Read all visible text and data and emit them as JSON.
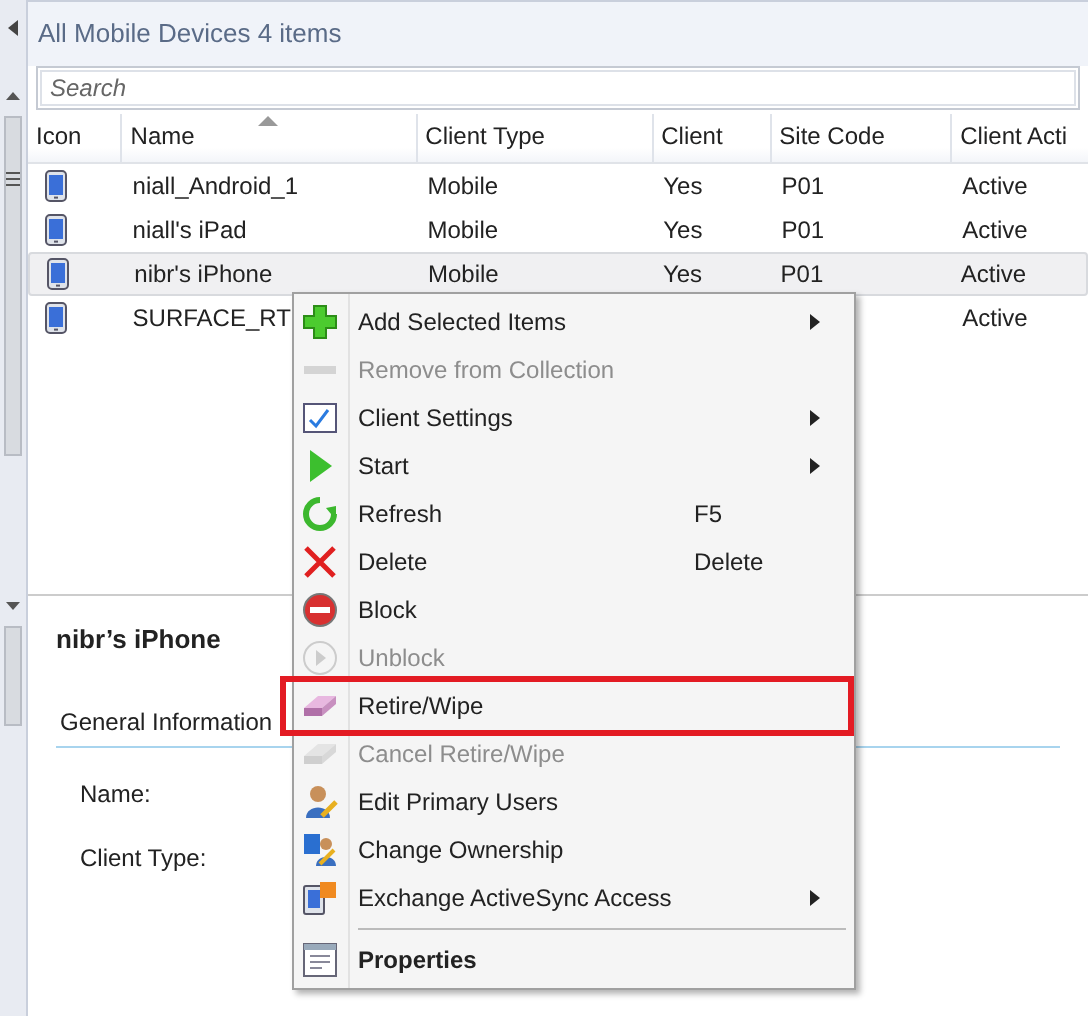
{
  "header": {
    "title": "All Mobile Devices 4 items"
  },
  "search": {
    "placeholder": "Search"
  },
  "table": {
    "columns": [
      {
        "label": "Icon",
        "sorted": false
      },
      {
        "label": "Name",
        "sorted": true
      },
      {
        "label": "Client Type",
        "sorted": false
      },
      {
        "label": "Client",
        "sorted": false
      },
      {
        "label": "Site Code",
        "sorted": false
      },
      {
        "label": "Client Acti",
        "sorted": false
      }
    ],
    "rows": [
      {
        "selected": false,
        "cells": [
          "",
          "niall_Android_1",
          "Mobile",
          "Yes",
          "P01",
          "Active"
        ]
      },
      {
        "selected": false,
        "cells": [
          "",
          "niall's iPad",
          "Mobile",
          "Yes",
          "P01",
          "Active"
        ]
      },
      {
        "selected": true,
        "cells": [
          "",
          "nibr's iPhone",
          "Mobile",
          "Yes",
          "P01",
          "Active"
        ]
      },
      {
        "selected": false,
        "cells": [
          "",
          "SURFACE_RT",
          "",
          "",
          "",
          "Active"
        ]
      }
    ]
  },
  "details": {
    "title": "nibr’s iPhone",
    "section": "General Information",
    "fields": [
      "Name:",
      "Client Type:"
    ]
  },
  "context_menu": {
    "items": [
      {
        "kind": "item",
        "label": "Add Selected Items",
        "disabled": false,
        "submenu": true,
        "highlighted": false,
        "default": false
      },
      {
        "kind": "item",
        "label": "Remove from Collection",
        "disabled": true,
        "submenu": false,
        "highlighted": false,
        "default": false
      },
      {
        "kind": "item",
        "label": "Client Settings",
        "disabled": false,
        "submenu": true,
        "highlighted": false,
        "default": false
      },
      {
        "kind": "item",
        "label": "Start",
        "disabled": false,
        "submenu": true,
        "highlighted": false,
        "default": false
      },
      {
        "kind": "item",
        "label": "Refresh",
        "shortcut": "F5",
        "disabled": false,
        "submenu": false,
        "highlighted": false,
        "default": false
      },
      {
        "kind": "item",
        "label": "Delete",
        "shortcut": "Delete",
        "disabled": false,
        "submenu": false,
        "highlighted": false,
        "default": false
      },
      {
        "kind": "item",
        "label": "Block",
        "disabled": false,
        "submenu": false,
        "highlighted": false,
        "default": false
      },
      {
        "kind": "item",
        "label": "Unblock",
        "disabled": true,
        "submenu": false,
        "highlighted": false,
        "default": false
      },
      {
        "kind": "item",
        "label": "Retire/Wipe",
        "disabled": false,
        "submenu": false,
        "highlighted": true,
        "default": false
      },
      {
        "kind": "item",
        "label": "Cancel Retire/Wipe",
        "disabled": true,
        "submenu": false,
        "highlighted": false,
        "default": false
      },
      {
        "kind": "item",
        "label": "Edit Primary Users",
        "disabled": false,
        "submenu": false,
        "highlighted": false,
        "default": false
      },
      {
        "kind": "item",
        "label": "Change Ownership",
        "disabled": false,
        "submenu": false,
        "highlighted": false,
        "default": false
      },
      {
        "kind": "item",
        "label": "Exchange ActiveSync Access",
        "disabled": false,
        "submenu": true,
        "highlighted": false,
        "default": false
      },
      {
        "kind": "separator"
      },
      {
        "kind": "item",
        "label": "Properties",
        "disabled": false,
        "submenu": false,
        "highlighted": false,
        "default": true
      }
    ]
  }
}
